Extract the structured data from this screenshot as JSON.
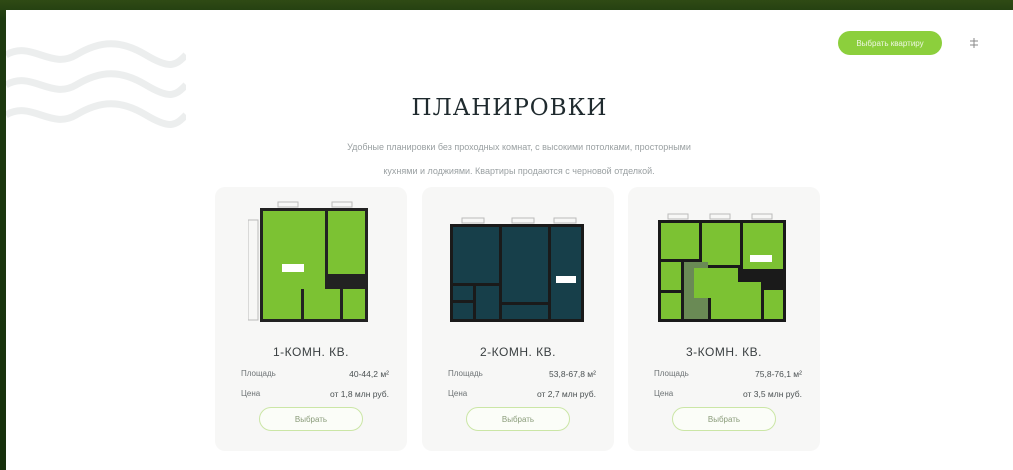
{
  "header": {
    "cta_label": "Выбрать квартиру"
  },
  "section": {
    "title": "ПЛАНИРОВКИ",
    "subtitle_line1": "Удобные планировки без проходных комнат, с высокими потолками, просторными",
    "subtitle_line2": "кухнями и лоджиями. Квартиры продаются с черновой отделкой."
  },
  "colors": {
    "accent": "#8ccf3c",
    "dark_plan": "#173f4a",
    "green_plan": "#7cc233"
  },
  "cards": [
    {
      "title": "1-КОМН. КВ.",
      "area_label": "Площадь",
      "area_value": "40-44,2 м²",
      "price_label": "Цена",
      "price_value": "от 1,8 млн руб.",
      "button_label": "Выбрать"
    },
    {
      "title": "2-КОМН. КВ.",
      "area_label": "Площадь",
      "area_value": "53,8-67,8 м²",
      "price_label": "Цена",
      "price_value": "от 2,7 млн руб.",
      "button_label": "Выбрать"
    },
    {
      "title": "3-КОМН. КВ.",
      "area_label": "Площадь",
      "area_value": "75,8-76,1 м²",
      "price_label": "Цена",
      "price_value": "от 3,5 млн руб.",
      "button_label": "Выбрать"
    }
  ]
}
